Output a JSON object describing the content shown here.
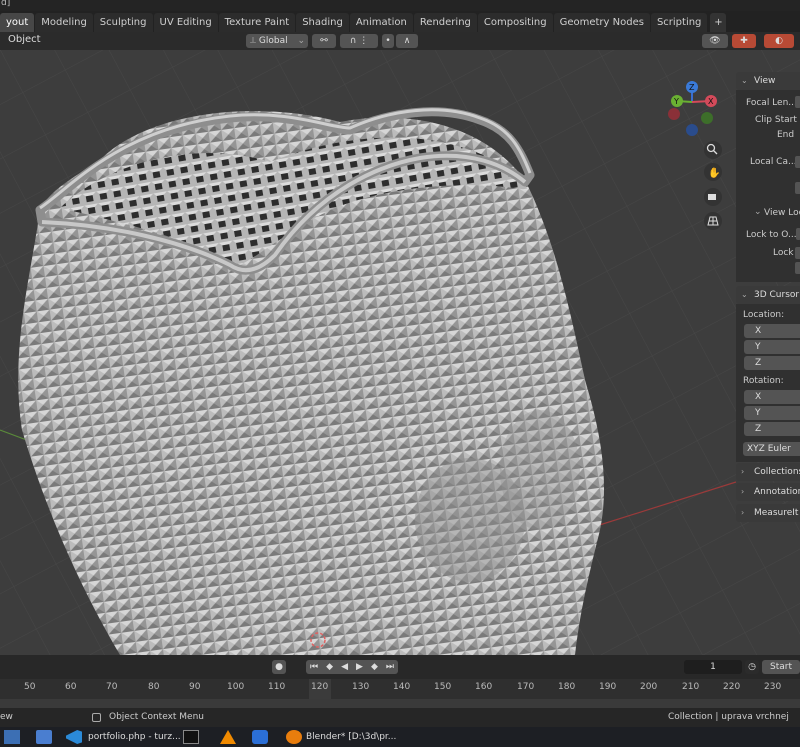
{
  "title_fragment": "d]",
  "tabs": [
    "yout",
    "Modeling",
    "Sculpting",
    "UV Editing",
    "Texture Paint",
    "Shading",
    "Animation",
    "Rendering",
    "Compositing",
    "Geometry Nodes",
    "Scripting",
    "+"
  ],
  "active_tab_index": 0,
  "viewport_header": {
    "mode": "Object",
    "transform_orientation": "Global"
  },
  "navigation_gizmo": {
    "z": "Z",
    "y": "Y",
    "x": "X"
  },
  "npanel": {
    "view": {
      "header": "View",
      "focal_length": "Focal Len...",
      "clip_start": "Clip Start",
      "clip_end": "End",
      "local_camera": "Local Ca...",
      "view_lock_header": "View Lock",
      "lock_to_object": "Lock to O...",
      "lock": "Lock"
    },
    "cursor": {
      "header": "3D Cursor",
      "location_label": "Location:",
      "location_axes": [
        "X",
        "Y",
        "Z"
      ],
      "rotation_label": "Rotation:",
      "rotation_axes": [
        "X",
        "Y",
        "Z"
      ],
      "rotation_mode": "XYZ Euler"
    },
    "collapsed": [
      "Collections",
      "Annotations",
      "MeasureIt T"
    ]
  },
  "timeline": {
    "current_frame": "1",
    "start_label": "Start",
    "ruler_ticks": [
      "50",
      "60",
      "70",
      "80",
      "90",
      "100",
      "110",
      "120",
      "130",
      "140",
      "150",
      "160",
      "170",
      "180",
      "190",
      "200",
      "210",
      "220",
      "230"
    ],
    "current_frame_highlight": "120"
  },
  "status_bar": {
    "left": "ew",
    "context_menu": "Object Context Menu",
    "right": "Collection | uprava vrchnej casti |"
  },
  "taskbar": {
    "vscode_label": "portfolio.php - turz...",
    "blender_label": "Blender* [D:\\3d\\pr..."
  }
}
